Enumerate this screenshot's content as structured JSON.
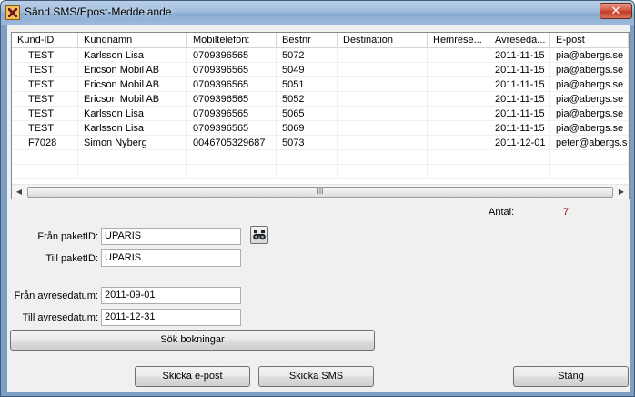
{
  "window": {
    "title": "Sänd SMS/Epost-Meddelande",
    "close_label": "✕"
  },
  "list": {
    "columns": [
      "Kund-ID",
      "Kundnamn",
      "Mobiltelefon:",
      "Bestnr",
      "Destination",
      "Hemrese...",
      "Avreseda...",
      "E-post"
    ],
    "rows": [
      [
        "TEST",
        "Karlsson Lisa",
        "0709396565",
        "5072",
        "",
        "",
        "2011-11-15",
        "pia@abergs.se"
      ],
      [
        "TEST",
        "Ericson Mobil AB",
        "0709396565",
        "5049",
        "",
        "",
        "2011-11-15",
        "pia@abergs.se"
      ],
      [
        "TEST",
        "Ericson Mobil AB",
        "0709396565",
        "5051",
        "",
        "",
        "2011-11-15",
        "pia@abergs.se"
      ],
      [
        "TEST",
        "Ericson Mobil AB",
        "0709396565",
        "5052",
        "",
        "",
        "2011-11-15",
        "pia@abergs.se"
      ],
      [
        "TEST",
        "Karlsson Lisa",
        "0709396565",
        "5065",
        "",
        "",
        "2011-11-15",
        "pia@abergs.se"
      ],
      [
        "TEST",
        "Karlsson Lisa",
        "0709396565",
        "5069",
        "",
        "",
        "2011-11-15",
        "pia@abergs.se"
      ],
      [
        "F7028",
        "Simon Nyberg",
        "0046705329687",
        "5073",
        "",
        "",
        "2011-12-01",
        "peter@abergs.se"
      ]
    ],
    "scroll_grip": "III"
  },
  "count": {
    "label": "Antal:",
    "value": "7",
    "value_color": "#a00000"
  },
  "form": {
    "fran_paket_label": "Från paketID:",
    "fran_paket_value": "UPARIS",
    "till_paket_label": "Till paketID:",
    "till_paket_value": "UPARIS",
    "fran_avrese_label": "Från avresedatum:",
    "fran_avrese_value": "2011-09-01",
    "till_avrese_label": "Till avresedatum:",
    "till_avrese_value": "2011-12-31"
  },
  "buttons": {
    "search": "Sök bokningar",
    "send_email": "Skicka e-post",
    "send_sms": "Skicka SMS",
    "close": "Stäng"
  },
  "icons": {
    "search_packages": "binoculars-icon",
    "app": "app-icon"
  }
}
